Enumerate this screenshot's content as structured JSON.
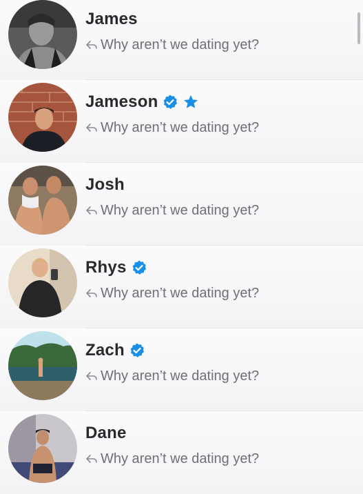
{
  "colors": {
    "verified_blue": "#1a8fe8",
    "star_blue": "#1a8fe8",
    "name": "#2a2a2e",
    "message": "#6f6f78"
  },
  "matches": [
    {
      "name": "James",
      "last_message": "Why aren’t we dating yet?",
      "badges": [],
      "reply_icon": "reply-arrow-icon"
    },
    {
      "name": "Jameson",
      "last_message": "Why aren’t we dating yet?",
      "badges": [
        "verified-badge-icon",
        "super-like-star-icon"
      ],
      "reply_icon": "reply-arrow-icon"
    },
    {
      "name": "Josh",
      "last_message": "Why aren’t we dating yet?",
      "badges": [],
      "reply_icon": "reply-arrow-icon"
    },
    {
      "name": "Rhys",
      "last_message": "Why aren’t we dating yet?",
      "badges": [
        "verified-badge-icon"
      ],
      "reply_icon": "reply-arrow-icon"
    },
    {
      "name": "Zach",
      "last_message": "Why aren’t we dating yet?",
      "badges": [
        "verified-badge-icon"
      ],
      "reply_icon": "reply-arrow-icon"
    },
    {
      "name": "Dane",
      "last_message": "Why aren’t we dating yet?",
      "badges": [],
      "reply_icon": "reply-arrow-icon"
    }
  ]
}
